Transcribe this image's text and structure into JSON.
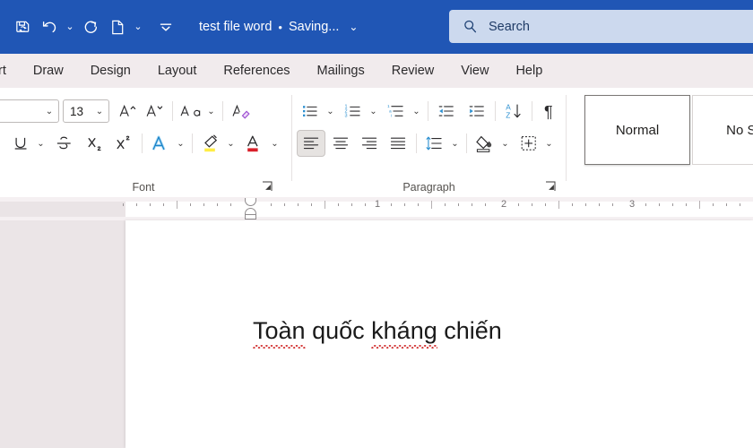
{
  "titlebar": {
    "quick_access": [
      {
        "name": "autosave-save-icon",
        "label": "Save"
      },
      {
        "name": "undo-icon",
        "label": "Undo",
        "has_caret": true
      },
      {
        "name": "redo-icon",
        "label": "Redo"
      },
      {
        "name": "new-document-icon",
        "label": "New",
        "has_caret": true
      },
      {
        "name": "customize-quick-access-toolbar-icon",
        "label": "Customize Quick Access Toolbar"
      }
    ],
    "document_name": "test file word",
    "separator_dot": "•",
    "save_status": "Saving...",
    "title_caret": "⌄",
    "background_color": "#2056b5"
  },
  "search": {
    "icon": "search-icon",
    "placeholder": "Search",
    "background_color": "#ccd9ee"
  },
  "tabs": [
    {
      "label": "rt",
      "name": "tab-insert-truncated"
    },
    {
      "label": "Draw",
      "name": "tab-draw"
    },
    {
      "label": "Design",
      "name": "tab-design"
    },
    {
      "label": "Layout",
      "name": "tab-layout"
    },
    {
      "label": "References",
      "name": "tab-references"
    },
    {
      "label": "Mailings",
      "name": "tab-mailings"
    },
    {
      "label": "Review",
      "name": "tab-review"
    },
    {
      "label": "View",
      "name": "tab-view"
    },
    {
      "label": "Help",
      "name": "tab-help"
    }
  ],
  "ribbon": {
    "font_group": {
      "label": "Font",
      "font_name_value": "",
      "font_size_value": "13",
      "buttons_row1": [
        {
          "name": "grow-font-icon",
          "label": "Increase Font Size"
        },
        {
          "name": "shrink-font-icon",
          "label": "Decrease Font Size"
        },
        {
          "name": "change-case-icon",
          "label": "Change Case"
        },
        {
          "name": "clear-formatting-icon",
          "label": "Clear All Formatting"
        }
      ],
      "buttons_row2": [
        {
          "name": "underline-icon",
          "label": "Underline"
        },
        {
          "name": "strikethrough-icon",
          "label": "Strikethrough"
        },
        {
          "name": "subscript-icon",
          "label": "Subscript"
        },
        {
          "name": "superscript-icon",
          "label": "Superscript"
        },
        {
          "name": "text-effects-icon",
          "label": "Text Effects and Typography"
        },
        {
          "name": "text-highlight-color-icon",
          "label": "Text Highlight Color",
          "color": "#ffed45"
        },
        {
          "name": "font-color-icon",
          "label": "Font Color",
          "color": "#d9202a"
        }
      ]
    },
    "paragraph_group": {
      "label": "Paragraph",
      "buttons_row1": [
        {
          "name": "bullets-icon",
          "label": "Bullets"
        },
        {
          "name": "numbering-icon",
          "label": "Numbering"
        },
        {
          "name": "multilevel-list-icon",
          "label": "Multilevel List"
        },
        {
          "name": "decrease-indent-icon",
          "label": "Decrease Indent"
        },
        {
          "name": "increase-indent-icon",
          "label": "Increase Indent"
        },
        {
          "name": "sort-icon",
          "label": "Sort"
        },
        {
          "name": "show-formatting-marks-icon",
          "label": "Show/Hide ¶"
        }
      ],
      "buttons_row2": [
        {
          "name": "align-left-icon",
          "label": "Align Left",
          "active": true
        },
        {
          "name": "align-center-icon",
          "label": "Center",
          "active": false
        },
        {
          "name": "align-right-icon",
          "label": "Align Right",
          "active": false
        },
        {
          "name": "justify-icon",
          "label": "Justify",
          "active": false
        },
        {
          "name": "line-spacing-icon",
          "label": "Line and Paragraph Spacing"
        },
        {
          "name": "shading-icon",
          "label": "Shading"
        },
        {
          "name": "borders-icon",
          "label": "Borders"
        }
      ]
    },
    "styles_group": {
      "cards": [
        {
          "label": "Normal",
          "selected": true
        },
        {
          "label": "No Sp",
          "selected": false
        }
      ]
    }
  },
  "ruler": {
    "numbers": [
      "1",
      "2",
      "3"
    ],
    "markers": [
      "first-line-indent",
      "hanging-indent",
      "left-indent"
    ]
  },
  "document": {
    "text": "Toàn quốc kháng chiến",
    "words": [
      {
        "text": "Toàn",
        "misspelled": true
      },
      {
        "text": "quốc",
        "misspelled": false
      },
      {
        "text": "kháng",
        "misspelled": true
      },
      {
        "text": "chiến",
        "misspelled": false
      }
    ],
    "spellcheck_color": "#d43b3b",
    "page_background": "#ffffff",
    "workspace_background": "#ebe5e7"
  }
}
